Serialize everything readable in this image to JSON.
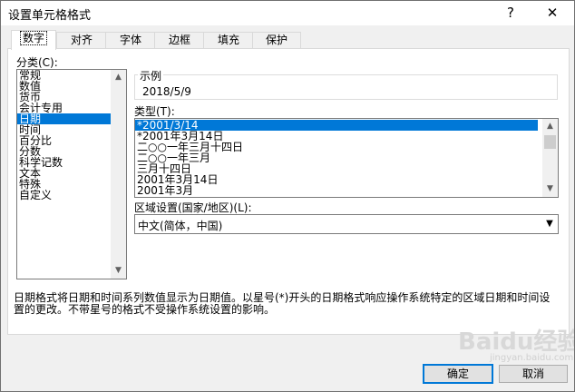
{
  "window": {
    "title": "设置单元格格式",
    "help_glyph": "?",
    "close_glyph": "✕"
  },
  "tabs": [
    {
      "label": "数字",
      "active": true
    },
    {
      "label": "对齐"
    },
    {
      "label": "字体"
    },
    {
      "label": "边框"
    },
    {
      "label": "填充"
    },
    {
      "label": "保护"
    }
  ],
  "category": {
    "label": "分类(C):",
    "items": [
      "常规",
      "数值",
      "货币",
      "会计专用",
      "日期",
      "时间",
      "百分比",
      "分数",
      "科学记数",
      "文本",
      "特殊",
      "自定义"
    ],
    "selected": "日期"
  },
  "sample": {
    "label": "示例",
    "value": "2018/5/9"
  },
  "type": {
    "label": "类型(T):",
    "items": [
      "*2001/3/14",
      "*2001年3月14日",
      "二○○一年三月十四日",
      "二○○一年三月",
      "三月十四日",
      "2001年3月14日",
      "2001年3月"
    ],
    "selected": "*2001/3/14"
  },
  "locale": {
    "label": "区域设置(国家/地区)(L):",
    "value": "中文(简体，中国)"
  },
  "description": "日期格式将日期和时间系列数值显示为日期值。以星号(*)开头的日期格式响应操作系统特定的区域日期和时间设置的更改。不带星号的格式不受操作系统设置的影响。",
  "buttons": {
    "ok": "确定",
    "cancel": "取消"
  },
  "watermark": {
    "text": "Baidu经验",
    "sub": "jingyan.baidu.com"
  }
}
